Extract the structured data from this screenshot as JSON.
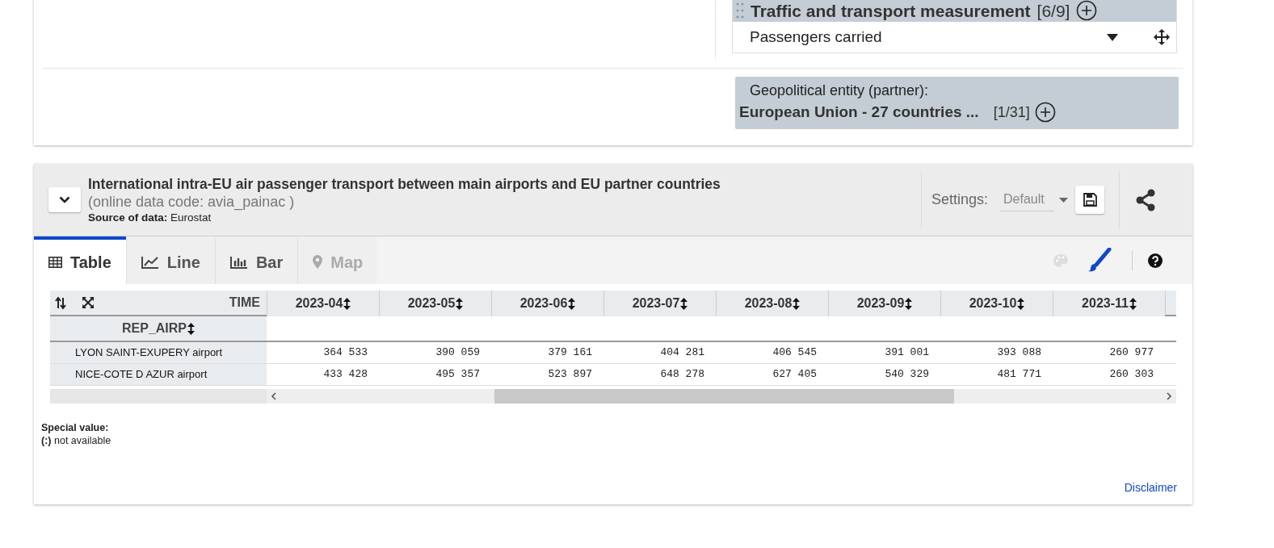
{
  "filters": {
    "dimension": {
      "title": "Traffic and transport measurement",
      "count": "[6/9]",
      "value": "Passengers carried"
    },
    "partner": {
      "label": "Geopolitical entity (partner):",
      "value": "European Union - 27 countries ...",
      "count": "[1/31]"
    }
  },
  "dataset": {
    "title": "International intra-EU air passenger transport between main airports and EU partner countries",
    "code": "(online data code: avia_painac )",
    "source_label": "Source of data:",
    "source": "Eurostat",
    "settings_label": "Settings:",
    "settings_value": "Default"
  },
  "tabs": [
    {
      "label": "Table",
      "kind": "table",
      "selected": true,
      "disabled": false
    },
    {
      "label": "Line",
      "kind": "line",
      "selected": false,
      "disabled": false
    },
    {
      "label": "Bar",
      "kind": "bar",
      "selected": false,
      "disabled": false
    },
    {
      "label": "Map",
      "kind": "map",
      "selected": false,
      "disabled": true
    }
  ],
  "table": {
    "col_dimension": "TIME",
    "row_dimension": "REP_AIRP",
    "columns": [
      "2023-04",
      "2023-05",
      "2023-06",
      "2023-07",
      "2023-08",
      "2023-09",
      "2023-10",
      "2023-11"
    ],
    "rows": [
      {
        "label": "LYON SAINT-EXUPERY airport",
        "values": [
          "364 533",
          "390 059",
          "379 161",
          "404 281",
          "406 545",
          "391 001",
          "393 088",
          "260 977"
        ]
      },
      {
        "label": "NICE-COTE D AZUR airport",
        "values": [
          "433 428",
          "495 357",
          "523 897",
          "648 278",
          "627 405",
          "540 329",
          "481 771",
          "260 303"
        ]
      }
    ]
  },
  "legend": {
    "title": "Special value:",
    "symbol": "(:)",
    "text": "not available"
  },
  "disclaimer": "Disclaimer"
}
